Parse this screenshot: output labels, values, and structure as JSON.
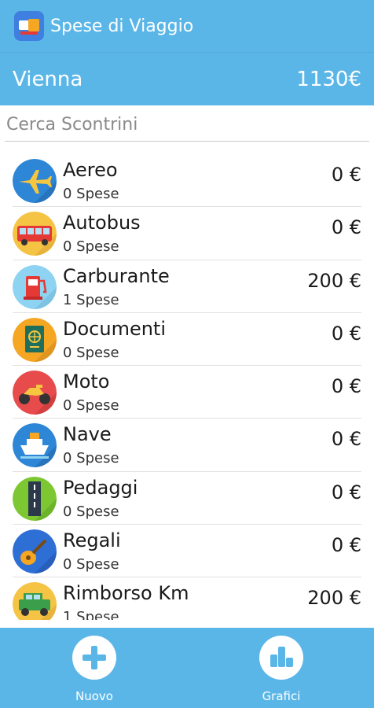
{
  "app": {
    "title": "Spese di Viaggio"
  },
  "trip": {
    "name": "Vienna",
    "total": "1130€"
  },
  "search": {
    "placeholder": "Cerca Scontrini"
  },
  "categories": [
    {
      "name": "Aereo",
      "count": "0 Spese",
      "amount": "0 €",
      "icon": "airplane-icon"
    },
    {
      "name": "Autobus",
      "count": "0 Spese",
      "amount": "0 €",
      "icon": "bus-icon"
    },
    {
      "name": "Carburante",
      "count": "1 Spese",
      "amount": "200 €",
      "icon": "fuel-pump-icon"
    },
    {
      "name": "Documenti",
      "count": "0 Spese",
      "amount": "0 €",
      "icon": "passport-icon"
    },
    {
      "name": "Moto",
      "count": "0 Spese",
      "amount": "0 €",
      "icon": "motorcycle-icon"
    },
    {
      "name": "Nave",
      "count": "0 Spese",
      "amount": "0 €",
      "icon": "ship-icon"
    },
    {
      "name": "Pedaggi",
      "count": "0 Spese",
      "amount": "0 €",
      "icon": "road-icon"
    },
    {
      "name": "Regali",
      "count": "0 Spese",
      "amount": "0 €",
      "icon": "guitar-icon"
    },
    {
      "name": "Rimborso Km",
      "count": "1 Spese",
      "amount": "200 €",
      "icon": "jeep-icon"
    }
  ],
  "nav": {
    "new_label": "Nuovo",
    "charts_label": "Grafici"
  },
  "colors": {
    "primary": "#5BB6E8",
    "divider": "#E2E2E2"
  }
}
